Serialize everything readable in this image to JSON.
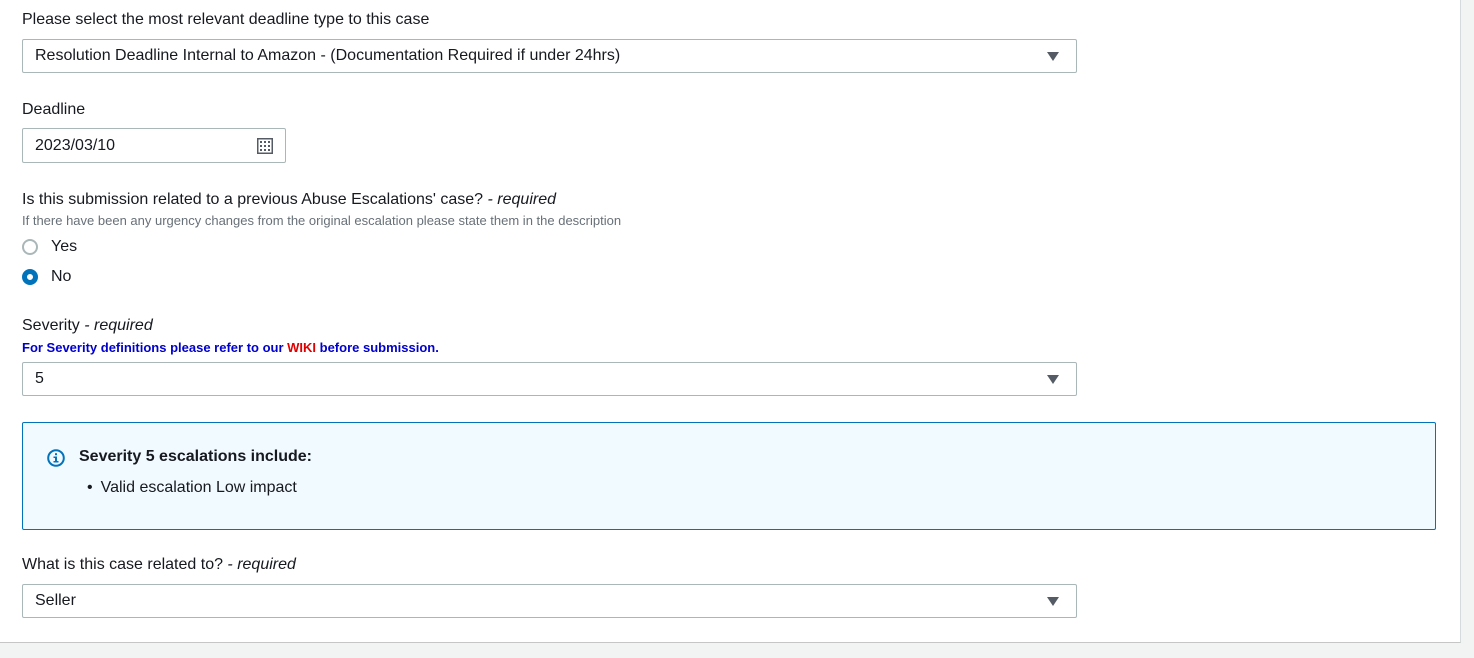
{
  "deadline_type": {
    "label": "Please select the most relevant deadline type to this case",
    "selected": "Resolution Deadline Internal to Amazon - (Documentation Required if under 24hrs)"
  },
  "deadline": {
    "label": "Deadline",
    "value": "2023/03/10"
  },
  "previous_case": {
    "label": "Is this submission related to a previous Abuse Escalations' case?",
    "required": " - required",
    "hint": "If there have been any urgency changes from the original escalation please state them in the description",
    "options": [
      {
        "label": "Yes",
        "checked": false
      },
      {
        "label": "No",
        "checked": true
      }
    ]
  },
  "severity": {
    "label": "Severity",
    "required": " - required",
    "note_prefix": "For Severity definitions please refer to our ",
    "note_link": "WIKI",
    "note_suffix": " before submission.",
    "selected": "5"
  },
  "severity_info": {
    "title": "Severity 5 escalations include:",
    "items": [
      "Valid escalation Low impact"
    ],
    "accent": "#0073bb"
  },
  "related_to": {
    "label": "What is this case related to?",
    "required": " - required",
    "selected": "Seller"
  }
}
